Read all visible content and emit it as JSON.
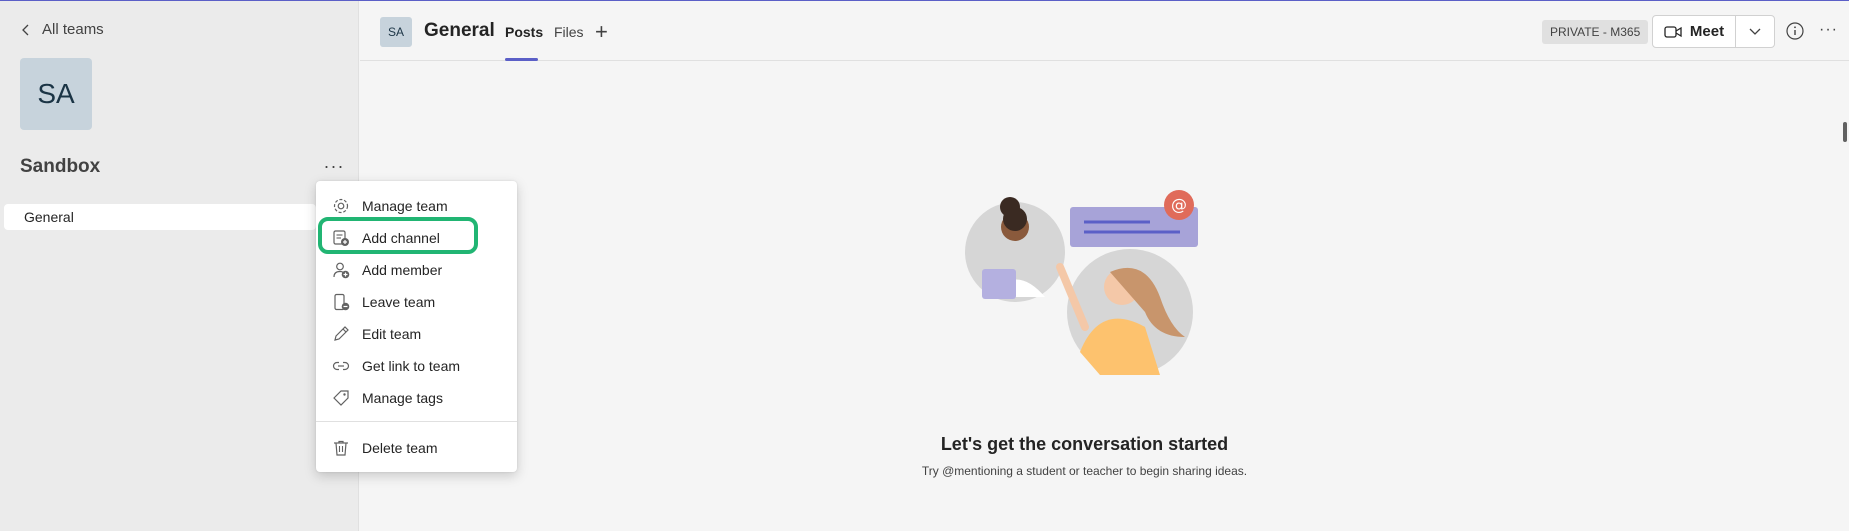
{
  "sidebar": {
    "back_label": "All teams",
    "team_initials": "SA",
    "team_name": "Sandbox",
    "more_label": "···",
    "channels": [
      {
        "label": "General"
      }
    ]
  },
  "header": {
    "channel_initials": "SA",
    "channel_title": "General",
    "tabs": [
      {
        "label": "Posts"
      },
      {
        "label": "Files"
      }
    ],
    "add_tab_label": "+",
    "privacy_badge": "PRIVATE - M365",
    "meet_label": "Meet",
    "more_label": "···"
  },
  "menu": {
    "items": [
      {
        "label": "Manage team",
        "icon": "gear-icon"
      },
      {
        "label": "Add channel",
        "icon": "add-channel-icon"
      },
      {
        "label": "Add member",
        "icon": "add-member-icon"
      },
      {
        "label": "Leave team",
        "icon": "leave-team-icon"
      },
      {
        "label": "Edit team",
        "icon": "pencil-icon"
      },
      {
        "label": "Get link to team",
        "icon": "link-icon"
      },
      {
        "label": "Manage tags",
        "icon": "tag-icon"
      },
      {
        "label": "Delete team",
        "icon": "trash-icon"
      }
    ],
    "highlighted_item": "Add channel"
  },
  "main": {
    "empty_title": "Let's get the conversation started",
    "empty_subtitle": "Try @mentioning a student or teacher to begin sharing ideas."
  },
  "colors": {
    "accent": "#5b5fc7",
    "highlight_ring": "#21b573",
    "avatar_bg": "#c7d3dc",
    "mention_badge": "#e06b5a"
  }
}
